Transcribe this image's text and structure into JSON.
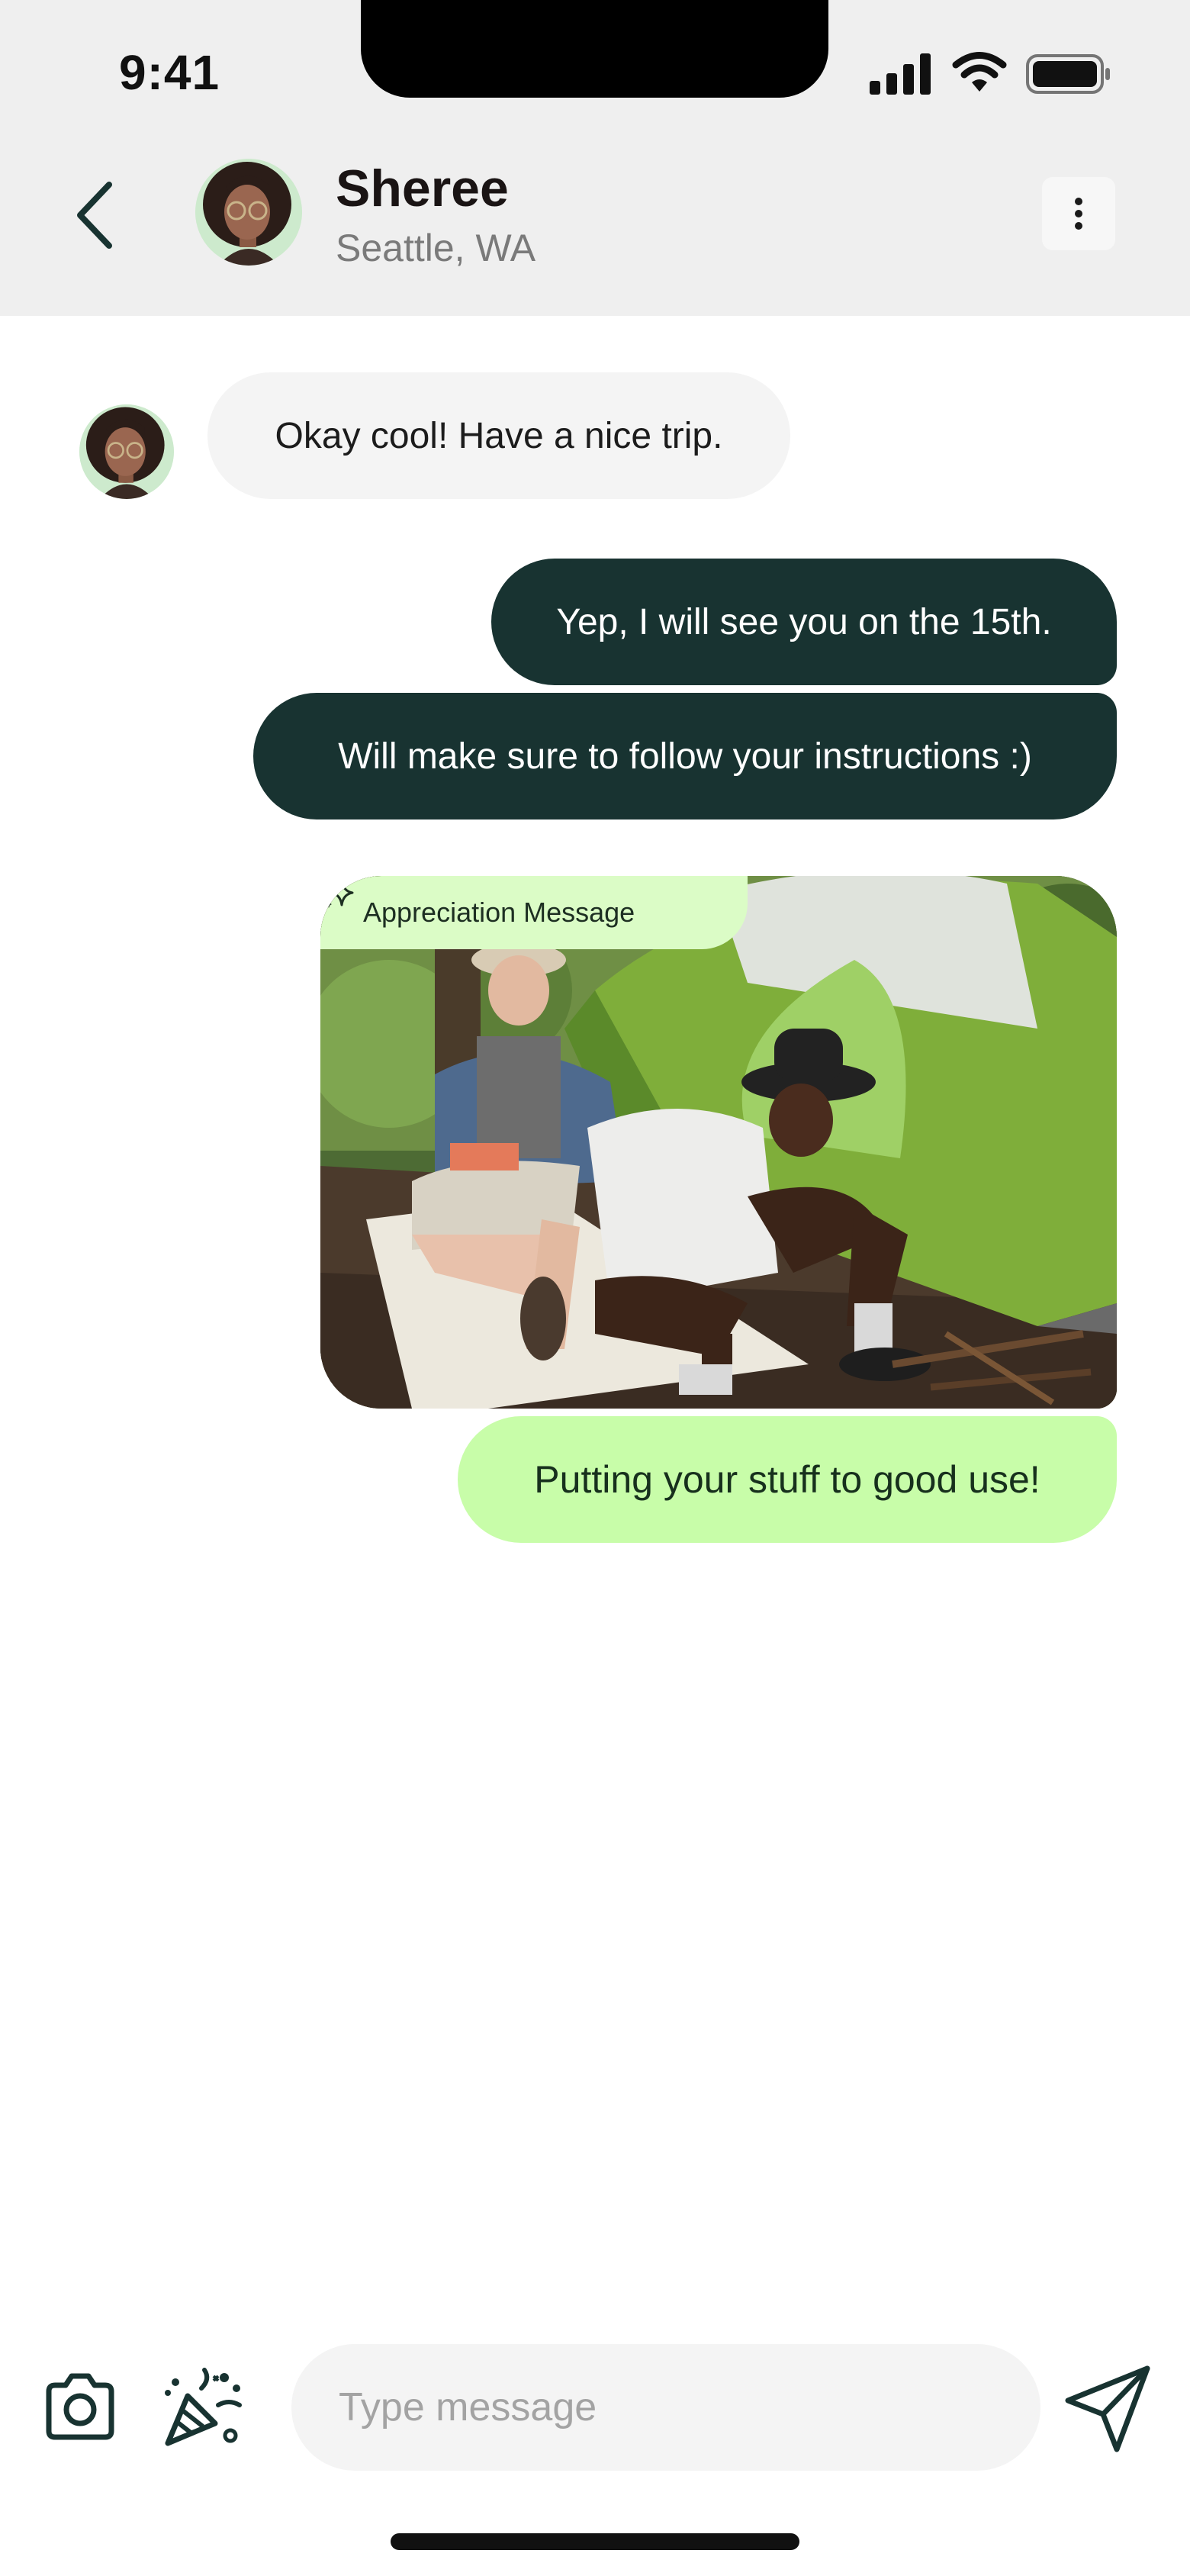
{
  "status_bar": {
    "time": "9:41"
  },
  "header": {
    "contact_name": "Sheree",
    "contact_location": "Seattle, WA"
  },
  "messages": [
    {
      "direction": "incoming",
      "text": "Okay cool! Have a nice trip."
    },
    {
      "direction": "outgoing",
      "text": "Yep, I will see you on the 15th."
    },
    {
      "direction": "outgoing",
      "text": "Will make sure to follow your instructions :)"
    },
    {
      "direction": "outgoing",
      "type": "appreciation",
      "tag_label": "Appreciation Message",
      "image_subject": "two people camping beside a green tent",
      "text": "Putting your stuff to good use!"
    }
  ],
  "composer": {
    "placeholder": "Type message"
  },
  "icons": {
    "back": "chevron-left-icon",
    "more": "vertical-dots-icon",
    "camera": "camera-icon",
    "confetti": "party-popper-icon",
    "send": "send-icon",
    "sparkle": "sparkle-icon"
  },
  "colors": {
    "header_bg": "#efefef",
    "outgoing_bubble": "#183331",
    "incoming_bubble": "#f4f4f4",
    "appreciation_bubble": "#c8fda9",
    "appreciation_tag": "#dbfcc6",
    "icon_dark": "#183331"
  }
}
